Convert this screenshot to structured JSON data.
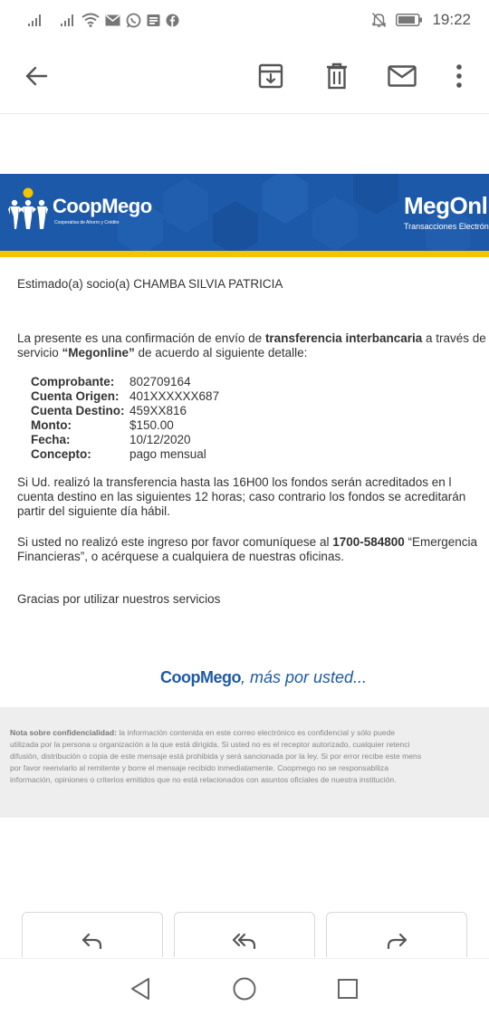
{
  "status_bar": {
    "time": "19:22",
    "icons": [
      "signal-icon",
      "signal-icon",
      "wifi-icon",
      "mail-icon",
      "whatsapp-icon",
      "news-icon",
      "facebook-icon",
      "mute-icon",
      "battery-icon"
    ]
  },
  "app_bar": {
    "icons": [
      "back-arrow-icon",
      "archive-icon",
      "delete-icon",
      "mail-unread-icon",
      "more-vert-icon"
    ]
  },
  "banner": {
    "logo": "CoopMego",
    "logo_sub": "Cooperativa de Ahorro y Crédito",
    "brand": "MegOnli",
    "brand_sub": "Transacciones Electrónica"
  },
  "email": {
    "greeting": "Estimado(a) socio(a) CHAMBA SILVIA PATRICIA",
    "intro_line1_pre": "La presente es una confirmación de envío de ",
    "intro_line1_bold": "transferencia interbancaria",
    "intro_line1_post": " a través de",
    "intro_line2_pre": "servicio ",
    "intro_line2_bold": "“Megonline”",
    "intro_line2_post": " de acuerdo al siguiente detalle:",
    "details": [
      {
        "label": "Comprobante:",
        "value": "802709164"
      },
      {
        "label": "Cuenta Origen:",
        "value": "401XXXXXX687"
      },
      {
        "label": "Cuenta Destino:",
        "value": "459XX816"
      },
      {
        "label": "Monto:",
        "value": "$150.00"
      },
      {
        "label": "Fecha:",
        "value": "10/12/2020"
      },
      {
        "label": "Concepto:",
        "value": "pago mensual"
      }
    ],
    "para1_line1": "Si Ud. realizó la transferencia hasta las 16H00 los fondos serán acreditados en l",
    "para1_line2": "cuenta destino en las siguientes 12 horas; caso contrario los fondos se acreditarán",
    "para1_line3": "partir del siguiente día hábil.",
    "para2_line1_pre": "Si usted no realizó este ingreso por favor comuníquese al ",
    "para2_line1_bold": "1700-584800",
    "para2_line1_post": " “Emergencia",
    "para2_line2": "Financieras”, o acérquese a cualquiera de nuestras oficinas.",
    "thanks": "Gracias por utilizar nuestros servicios",
    "signature_brand": "CoopMego",
    "signature_tag": ", más por usted...",
    "disclaimer_bold": "Nota sobre confidencialidad:",
    "disclaimer_line1": " la información contenida en este correo electrónico es confidencial y sólo puede",
    "disclaimer_line2": "utilizada por la persona u organización a la que está dirigida. Si usted no es el receptor autorizado, cualquier retenci",
    "disclaimer_line3": "difusión, distribución o copia de este mensaje está prohibida y será sancionada por la ley. Si por error recibe este mens",
    "disclaimer_line4": "por favor reenviarlo al remitente y borre el mensaje recibido inmediatamente. Coopmego no se responsabiliza",
    "disclaimer_line5": "información, opiniones o criterios emitidos que no está relacionados con asuntos oficiales de nuestra institución."
  },
  "actions": [
    "reply-icon",
    "reply-all-icon",
    "forward-icon"
  ],
  "nav_bar": [
    "nav-back-icon",
    "nav-home-icon",
    "nav-recents-icon"
  ]
}
